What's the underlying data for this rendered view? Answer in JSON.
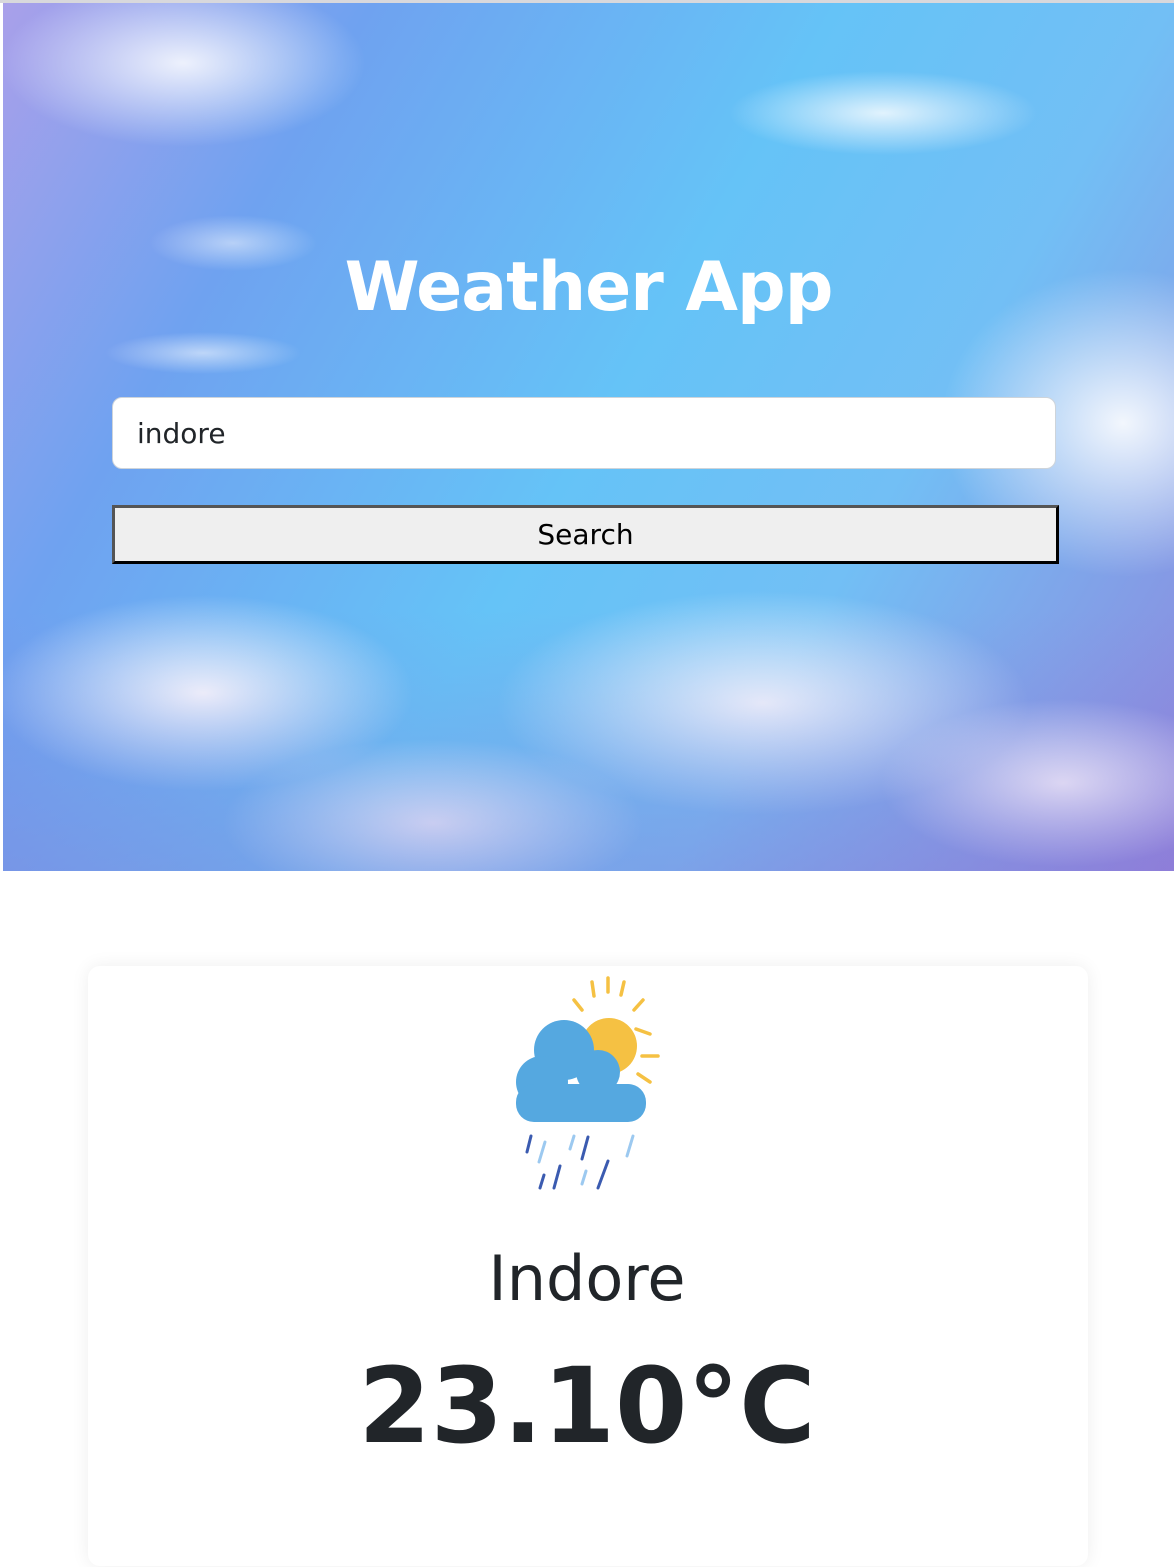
{
  "header": {
    "title": "Weather App"
  },
  "search": {
    "value": "indore",
    "button_label": "Search"
  },
  "weather": {
    "city": "Indore",
    "temperature": "23.10°C",
    "icon": "cloud-sun-rain-icon"
  },
  "colors": {
    "cloud": "#55a8e0",
    "sun": "#f5c143",
    "rain_dark": "#3b5bb0",
    "rain_light": "#9cc9f0",
    "text": "#212529"
  }
}
